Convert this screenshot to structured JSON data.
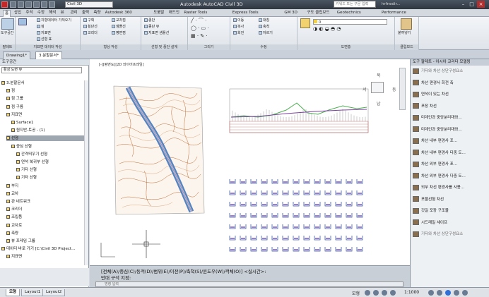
{
  "app": {
    "title": "Autodesk AutoCAD Civil 3D",
    "workspace": "Civil 3D",
    "search_placeholder": "키워드 또는 구문 입력",
    "user": "hrfnedir..."
  },
  "ribbon_tabs": [
    "홈",
    "삽입",
    "주석",
    "수정",
    "해석",
    "뷰",
    "관리",
    "출력",
    "측량",
    "Autodesk 360",
    "도움말",
    "애드인",
    "Raster Tools",
    "Express Tools",
    "GM 3D",
    "구도 클립보드",
    "Geotechnics",
    "Performance"
  ],
  "ribbon_active_tab": "홈",
  "ribbon_panels": [
    {
      "label": "팔레트",
      "items": [
        "도구공간"
      ]
    },
    {
      "label": "지표면 데이터 작성",
      "items": [
        "지형데이터 가져오기",
        "선형",
        "선형 표"
      ]
    },
    {
      "label": "형상 작성",
      "items": [
        "구획",
        "횡단선",
        "코리더",
        "교차점",
        "샘플선",
        "평면점"
      ]
    },
    {
      "label": "선형 및 종단 설계",
      "items": [
        "종단",
        "종단 뷰",
        "종단뷰",
        "지표면 샘플선"
      ]
    },
    {
      "label": "그리기",
      "items": [
        "선",
        "원",
        "호",
        "폴리선"
      ]
    },
    {
      "label": "수정",
      "items": [
        "이동",
        "복사",
        "회전",
        "대칭",
        "축척",
        "자르기",
        "연장"
      ]
    },
    {
      "label": "레이어",
      "items": [
        "레이어 특성",
        "0",
        "레이어 상태"
      ]
    },
    {
      "label": "도면층",
      "items": [
        "도면층"
      ]
    },
    {
      "label": "클립보드",
      "items": [
        "붙여넣기"
      ]
    }
  ],
  "doc_tabs": [
    "Drawing1*",
    "3.분할문서*"
  ],
  "doc_active": "3.분할문서*",
  "palette": {
    "title": "도구공간",
    "combo": "활성 도면 뷰",
    "tree": [
      {
        "label": "3.분할문서",
        "indent": 0
      },
      {
        "label": "점",
        "indent": 1
      },
      {
        "label": "점 그룹",
        "indent": 1
      },
      {
        "label": "점 구름",
        "indent": 1
      },
      {
        "label": "지표면",
        "indent": 1
      },
      {
        "label": "Surface1",
        "indent": 2
      },
      {
        "label": "원지반-토공 - (1)",
        "indent": 2
      },
      {
        "label": "선형",
        "indent": 1,
        "selected": true
      },
      {
        "label": "중심 선형",
        "indent": 2
      },
      {
        "label": "간격띄우기 선형",
        "indent": 3
      },
      {
        "label": "연석 복귀부 선형",
        "indent": 3
      },
      {
        "label": "기타 선형",
        "indent": 3
      },
      {
        "label": "기타 선형",
        "indent": 3
      },
      {
        "label": "부지",
        "indent": 1
      },
      {
        "label": "교차",
        "indent": 1
      },
      {
        "label": "관 네트워크",
        "indent": 1
      },
      {
        "label": "코리더",
        "indent": 1
      },
      {
        "label": "조립품",
        "indent": 1
      },
      {
        "label": "교차로",
        "indent": 1
      },
      {
        "label": "측량",
        "indent": 1
      },
      {
        "label": "뷰 프레임 그룹",
        "indent": 1
      },
      {
        "label": "데이터 바로 가기 [C:\\Civil 3D Project...",
        "indent": 0
      },
      {
        "label": "지표면",
        "indent": 1
      }
    ]
  },
  "drawing": {
    "label": "[-][평면도][2D 와이어프레임]",
    "viewcube": {
      "n": "북",
      "w": "서",
      "e": "동",
      "s": "남"
    }
  },
  "tool_palette": {
    "title": "도구 팔레트 - 아시아 코리더 모델링",
    "items": [
      {
        "label": "기타와 차선 상단구성요소",
        "dim": true
      },
      {
        "label": "차선 편경사 회전 축",
        "dim": false
      },
      {
        "label": "연석이 있는 차선",
        "dim": false
      },
      {
        "label": "포장 차선",
        "dim": false
      },
      {
        "label": "미데인과 중앙분리대와...",
        "dim": false
      },
      {
        "label": "미데인과 중앙분리대와...",
        "dim": false
      },
      {
        "label": "차선 내부 편경사 포...",
        "dim": false
      },
      {
        "label": "차선 내부 편경사 다중 도...",
        "dim": false
      },
      {
        "label": "차선 외부 편경사 포...",
        "dim": false
      },
      {
        "label": "차선 외부 편경사 다중 도...",
        "dim": false
      },
      {
        "label": "외부 차선 편경사를 사용...",
        "dim": false
      },
      {
        "label": "포물선형 차선",
        "dim": false
      },
      {
        "label": "갓길 포장 구조물",
        "dim": false
      },
      {
        "label": "시드레일 세이프",
        "dim": false
      },
      {
        "label": "기타와 차선 상단구성요소",
        "dim": true
      }
    ]
  },
  "command": {
    "line1": "[전체(A)/중심(C)/동적(D)/범위(E)/이전(P)/축척(S)/윈도우(W)/객체(O)] <실시간>:",
    "line2": "반대 구석 지정:",
    "placeholder": "명령 입력"
  },
  "layout_tabs": [
    "모형",
    "Layout1",
    "Layout2"
  ],
  "layout_active": "모형",
  "status": {
    "model": "모형",
    "scale": "1:1000"
  },
  "colors": {
    "titlebar": "#2f3640",
    "ribbon": "#eef1f4",
    "selection": "#9ea6b0",
    "profile_line": "#4caf50",
    "design_line": "#7b3fa0",
    "road": "#4a7bbd",
    "contour": "#b8642e"
  }
}
